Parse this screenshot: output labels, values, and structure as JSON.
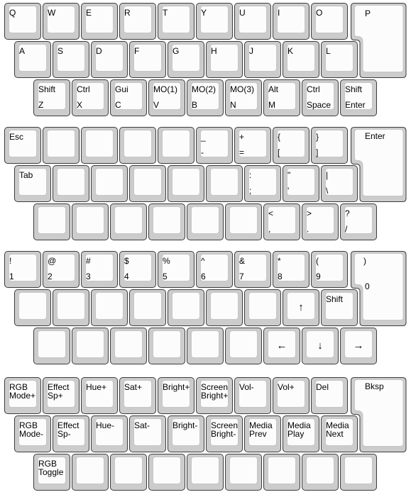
{
  "layers": [
    {
      "rows": [
        [
          {
            "t": "Q"
          },
          {
            "t": "W"
          },
          {
            "t": "E"
          },
          {
            "t": "R"
          },
          {
            "t": "T"
          },
          {
            "t": "Y"
          },
          {
            "t": "U"
          },
          {
            "t": "I"
          },
          {
            "t": "O"
          }
        ],
        [
          {
            "t": "A"
          },
          {
            "t": "S"
          },
          {
            "t": "D"
          },
          {
            "t": "F"
          },
          {
            "t": "G"
          },
          {
            "t": "H"
          },
          {
            "t": "J"
          },
          {
            "t": "K"
          },
          {
            "t": "L"
          }
        ],
        [
          {
            "t": "Shift",
            "b": "Z"
          },
          {
            "t": "Ctrl",
            "b": "X"
          },
          {
            "t": "Gui",
            "b": "C"
          },
          {
            "t": "MO(1)",
            "b": "V"
          },
          {
            "t": "MO(2)",
            "b": "B"
          },
          {
            "t": "MO(3)",
            "b": "N"
          },
          {
            "t": "Alt",
            "b": "M"
          },
          {
            "t": "Ctrl",
            "b": "Space"
          },
          {
            "t": "Shift",
            "b": "Enter"
          }
        ]
      ],
      "tall": {
        "label": "P"
      }
    },
    {
      "rows": [
        [
          {
            "t": "Esc"
          },
          {},
          {},
          {},
          {},
          {
            "t": "_",
            "b": "-"
          },
          {
            "t": "+",
            "b": "="
          },
          {
            "t": "{",
            "b": "["
          },
          {
            "t": "}",
            "b": "]"
          }
        ],
        [
          {
            "t": "Tab"
          },
          {},
          {},
          {},
          {},
          {},
          {
            "t": ":",
            "b": ";"
          },
          {
            "t": "\"",
            "b": "'"
          },
          {
            "t": "|",
            "b": "\\"
          }
        ],
        [
          {},
          {},
          {},
          {},
          {},
          {},
          {
            "t": "<",
            "b": ","
          },
          {
            "t": ">",
            "b": "."
          },
          {
            "t": "?",
            "b": "/"
          }
        ]
      ],
      "tall": {
        "label": "Enter"
      }
    },
    {
      "rows": [
        [
          {
            "t": "!",
            "b": "1"
          },
          {
            "t": "@",
            "b": "2"
          },
          {
            "t": "#",
            "b": "3"
          },
          {
            "t": "$",
            "b": "4"
          },
          {
            "t": "%",
            "b": "5"
          },
          {
            "t": "^",
            "b": "6"
          },
          {
            "t": "&",
            "b": "7"
          },
          {
            "t": "*",
            "b": "8"
          },
          {
            "t": "(",
            "b": "9"
          }
        ],
        [
          {},
          {},
          {},
          {},
          {},
          {},
          {},
          {
            "mid": "↑"
          },
          {
            "t": "Shift"
          }
        ],
        [
          {},
          {},
          {},
          {},
          {},
          {},
          {
            "mid": "←"
          },
          {
            "mid": "↓"
          },
          {
            "mid": "→"
          }
        ]
      ],
      "tall": {
        "label": ")",
        "label2": "0"
      }
    },
    {
      "rows": [
        [
          {
            "m": "RGB\nMode+"
          },
          {
            "m": "Effect\nSp+"
          },
          {
            "m": "Hue+"
          },
          {
            "m": "Sat+"
          },
          {
            "m": "Bright+"
          },
          {
            "m": "Screen\nBright+"
          },
          {
            "m": "Vol-"
          },
          {
            "m": "Vol+"
          },
          {
            "m": "Del"
          }
        ],
        [
          {
            "m": "RGB\nMode-"
          },
          {
            "m": "Effect\nSp-"
          },
          {
            "m": "Hue-"
          },
          {
            "m": "Sat-"
          },
          {
            "m": "Bright-"
          },
          {
            "m": "Screen\nBright-"
          },
          {
            "m": "Media\nPrev"
          },
          {
            "m": "Media\nPlay"
          },
          {
            "m": "Media\nNext"
          }
        ],
        [
          {
            "m": "RGB\nToggle"
          },
          {},
          {},
          {},
          {},
          {},
          {},
          {},
          {}
        ]
      ],
      "tall": {
        "label": "Bksp"
      }
    }
  ]
}
